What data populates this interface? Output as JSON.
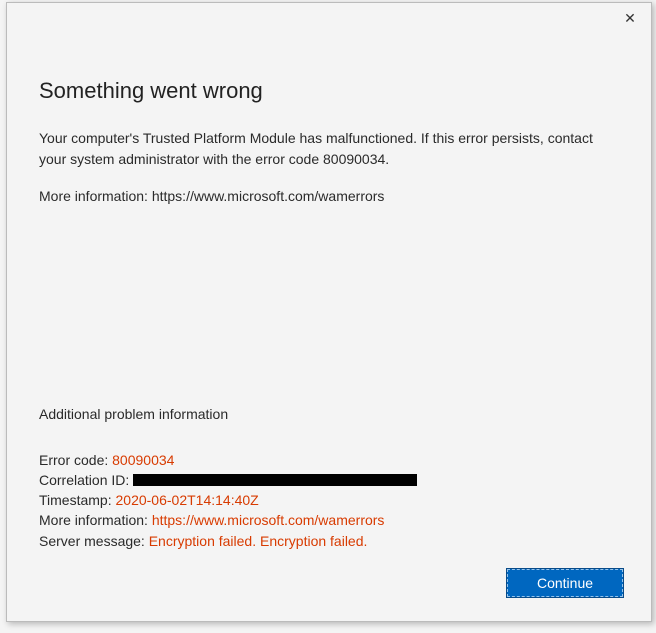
{
  "titlebar": {
    "close_icon": "✕"
  },
  "heading": "Something went wrong",
  "description": "Your computer's Trusted Platform Module has malfunctioned. If this error persists, contact your system administrator with the error code 80090034.",
  "more_info_top_label": "More information: ",
  "more_info_top_url": "https://www.microsoft.com/wamerrors",
  "additional_heading": "Additional problem information",
  "details": {
    "error_code_label": "Error code: ",
    "error_code_value": "80090034",
    "correlation_label": "Correlation ID: ",
    "timestamp_label": "Timestamp: ",
    "timestamp_value": "2020-06-02T14:14:40Z",
    "more_info_label": "More information: ",
    "more_info_url": "https://www.microsoft.com/wamerrors",
    "server_message_label": "Server message: ",
    "server_message_value": "Encryption failed. Encryption failed."
  },
  "buttons": {
    "continue": "Continue"
  }
}
